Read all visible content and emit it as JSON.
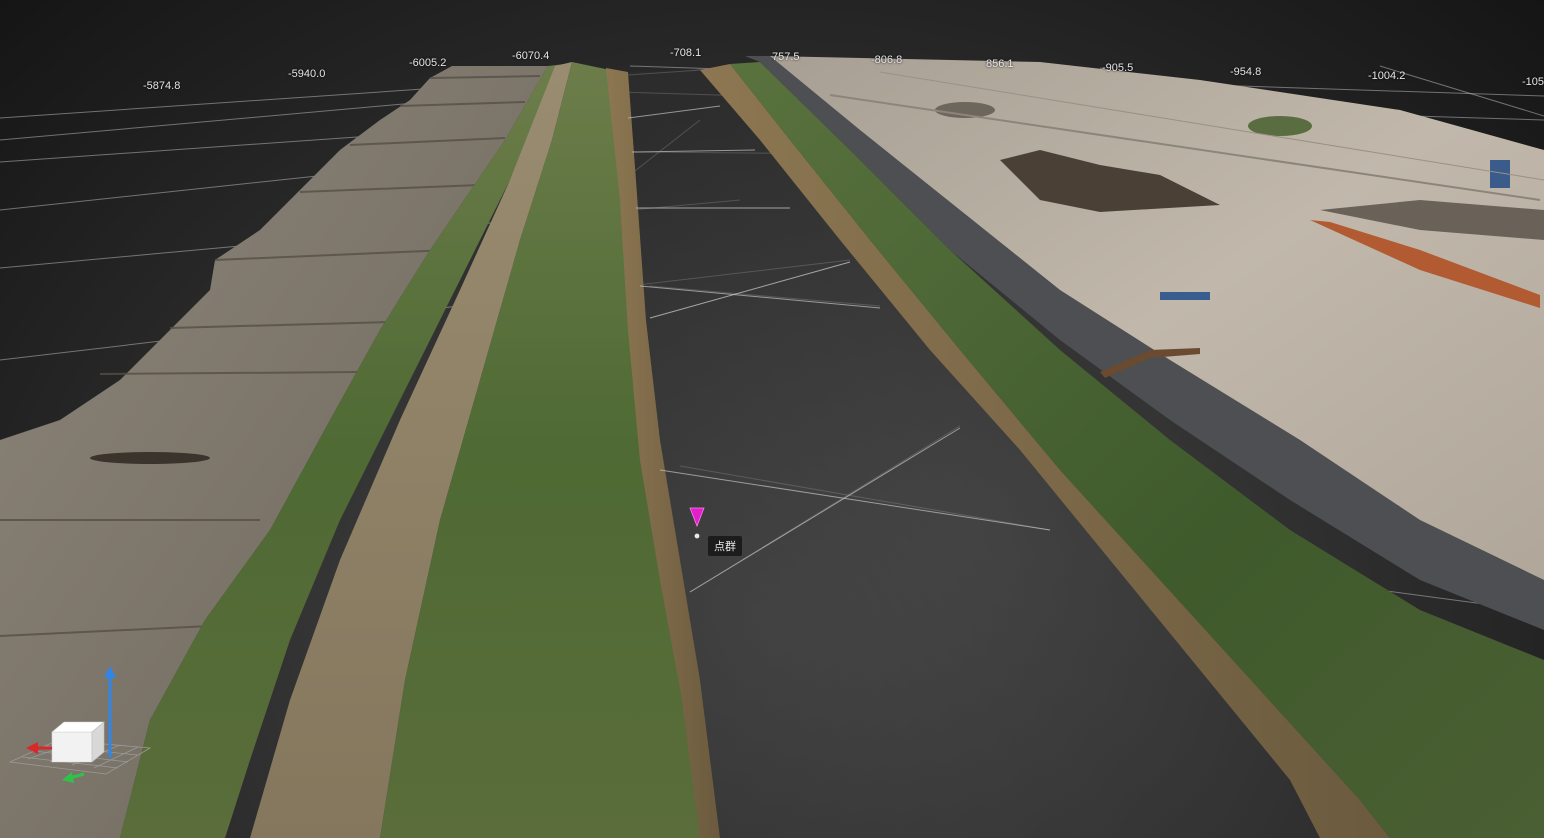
{
  "viewer": {
    "axis_labels_x": [
      "-5874.8",
      "-5940.0",
      "-6005.2",
      "-6070.4",
      "-708.1",
      "757.5",
      "-806.8",
      "856.1",
      "-905.5",
      "-954.8",
      "-1004.2",
      "-105"
    ],
    "point_marker": {
      "label": "点群",
      "color": "#e020c8"
    },
    "orientation_gizmo": {
      "up_axis_color": "#2f86e6",
      "x_axis_color": "#d62a2a",
      "y_axis_color": "#2fc24a",
      "cube_color": "#f2f2f2"
    },
    "colors": {
      "background": "#2a2a2a",
      "grid_line": "#b8b8b8",
      "grass": "#4d6a35",
      "field": "#7a7368",
      "dirt_road": "#8a7c63",
      "paved_road": "#4d4f52",
      "construction_site": "#b7ada0"
    }
  }
}
